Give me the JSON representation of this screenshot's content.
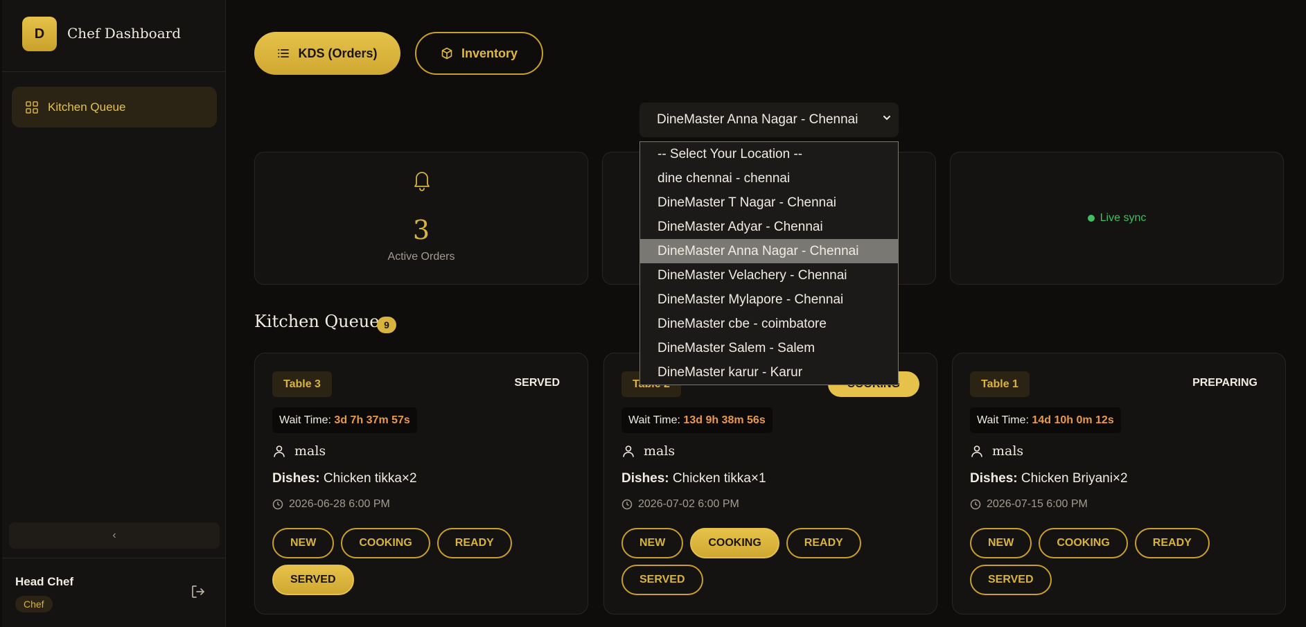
{
  "sidebar": {
    "logo_letter": "D",
    "app_title": "Chef Dashboard",
    "items": [
      {
        "label": "Kitchen Queue"
      }
    ],
    "collapse_glyph": "‹",
    "user": {
      "name": "Head Chef",
      "role": "Chef"
    }
  },
  "tabs": [
    {
      "label": "KDS (Orders)",
      "active": true,
      "icon": "list-icon"
    },
    {
      "label": "Inventory",
      "active": false,
      "icon": "box-icon"
    }
  ],
  "location": {
    "selected": "DineMaster Anna Nagar - Chennai",
    "options": [
      "-- Select Your Location --",
      "dine chennai - chennai",
      "DineMaster T Nagar - Chennai",
      "DineMaster Adyar - Chennai",
      "DineMaster Anna Nagar - Chennai",
      "DineMaster Velachery - Chennai",
      "DineMaster Mylapore - Chennai",
      "DineMaster cbe - coimbatore",
      "DineMaster Salem - Salem",
      "DineMaster karur - Karur"
    ],
    "selected_index": 4
  },
  "stats": {
    "active_orders": {
      "value": "3",
      "label": "Active Orders"
    },
    "live": {
      "label": "Live sync"
    }
  },
  "queue": {
    "title": "Kitchen Queue",
    "count": "9",
    "orders": [
      {
        "table": "Table 3",
        "status": "SERVED",
        "wait_label": "Wait Time:",
        "wait": "3d 7h 37m 57s",
        "customer": "mals",
        "dishes_label": "Dishes:",
        "dishes": "Chicken tikka×2",
        "time": "2026-06-28 6:00 PM",
        "active_button": "SERVED"
      },
      {
        "table": "Table 2",
        "status": "COOKING",
        "wait_label": "Wait Time:",
        "wait": "13d 9h 38m 56s",
        "customer": "mals",
        "dishes_label": "Dishes:",
        "dishes": "Chicken tikka×1",
        "time": "2026-07-02 6:00 PM",
        "active_button": "COOKING"
      },
      {
        "table": "Table 1",
        "status": "PREPARING",
        "wait_label": "Wait Time:",
        "wait": "14d 10h 0m 12s",
        "customer": "mals",
        "dishes_label": "Dishes:",
        "dishes": "Chicken Briyani×2",
        "time": "2026-07-15 6:00 PM",
        "active_button": "NONE"
      }
    ],
    "buttons": [
      "NEW",
      "COOKING",
      "READY",
      "SERVED"
    ]
  },
  "colors": {
    "accent": "#d8b33e",
    "background": "#0f0d0b",
    "live": "#3fbf62",
    "wait": "#e89a4a"
  }
}
